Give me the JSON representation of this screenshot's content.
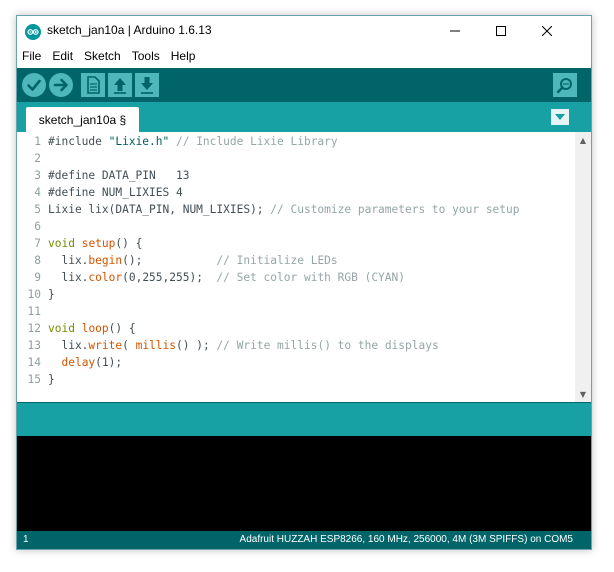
{
  "window": {
    "title": "sketch_jan10a | Arduino 1.6.13",
    "controls": {
      "minimize": "—",
      "maximize": "☐",
      "close": "✕"
    }
  },
  "menu": [
    "File",
    "Edit",
    "Sketch",
    "Tools",
    "Help"
  ],
  "toolbar": {
    "buttons": [
      "verify-icon",
      "upload-icon",
      "new-icon",
      "open-icon",
      "save-icon"
    ],
    "serial_monitor_icon": "serial-monitor-icon"
  },
  "tabs": [
    {
      "label": "sketch_jan10a §"
    }
  ],
  "editor": {
    "lines": [
      "1",
      "2",
      "3",
      "4",
      "5",
      "6",
      "7",
      "8",
      "9",
      "10",
      "11",
      "12",
      "13",
      "14",
      "15"
    ],
    "code": [
      [
        {
          "t": "#include ",
          "c": ""
        },
        {
          "t": "\"Lixie.h\"",
          "c": "str"
        },
        {
          "t": " // Include Lixie Library",
          "c": "cm"
        }
      ],
      [],
      [
        {
          "t": "#define DATA_PIN   13",
          "c": ""
        }
      ],
      [
        {
          "t": "#define NUM_LIXIES 4",
          "c": ""
        }
      ],
      [
        {
          "t": "Lixie lix(DATA_PIN, NUM_LIXIES); ",
          "c": ""
        },
        {
          "t": "// Customize parameters to your setup",
          "c": "cm"
        }
      ],
      [],
      [
        {
          "t": "void",
          "c": "kw"
        },
        {
          "t": " ",
          "c": ""
        },
        {
          "t": "setup",
          "c": "fn"
        },
        {
          "t": "() {",
          "c": ""
        }
      ],
      [
        {
          "t": "  lix.",
          "c": ""
        },
        {
          "t": "begin",
          "c": "fn"
        },
        {
          "t": "();           ",
          "c": ""
        },
        {
          "t": "// Initialize LEDs",
          "c": "cm"
        }
      ],
      [
        {
          "t": "  lix.",
          "c": ""
        },
        {
          "t": "color",
          "c": "fn"
        },
        {
          "t": "(0,255,255);  ",
          "c": ""
        },
        {
          "t": "// Set color with RGB (CYAN)",
          "c": "cm"
        }
      ],
      [
        {
          "t": "}",
          "c": ""
        }
      ],
      [],
      [
        {
          "t": "void",
          "c": "kw"
        },
        {
          "t": " ",
          "c": ""
        },
        {
          "t": "loop",
          "c": "fn"
        },
        {
          "t": "() {",
          "c": ""
        }
      ],
      [
        {
          "t": "  lix.",
          "c": ""
        },
        {
          "t": "write",
          "c": "fn"
        },
        {
          "t": "( ",
          "c": ""
        },
        {
          "t": "millis",
          "c": "fn"
        },
        {
          "t": "() ); ",
          "c": ""
        },
        {
          "t": "// Write millis() to the displays",
          "c": "cm"
        }
      ],
      [
        {
          "t": "  ",
          "c": ""
        },
        {
          "t": "delay",
          "c": "fn"
        },
        {
          "t": "(1);",
          "c": ""
        }
      ],
      [
        {
          "t": "}",
          "c": ""
        }
      ]
    ]
  },
  "status": {
    "line": "1",
    "board": "Adafruit HUZZAH ESP8266, 160 MHz, 256000, 4M (3M SPIFFS) on COM5"
  },
  "colors": {
    "toolbar": "#006468",
    "tabstrip": "#17a1a5",
    "button": "#4db7bb",
    "keyword": "#728e00",
    "function": "#d35400",
    "string": "#005c5f",
    "comment": "#95a5a6"
  }
}
